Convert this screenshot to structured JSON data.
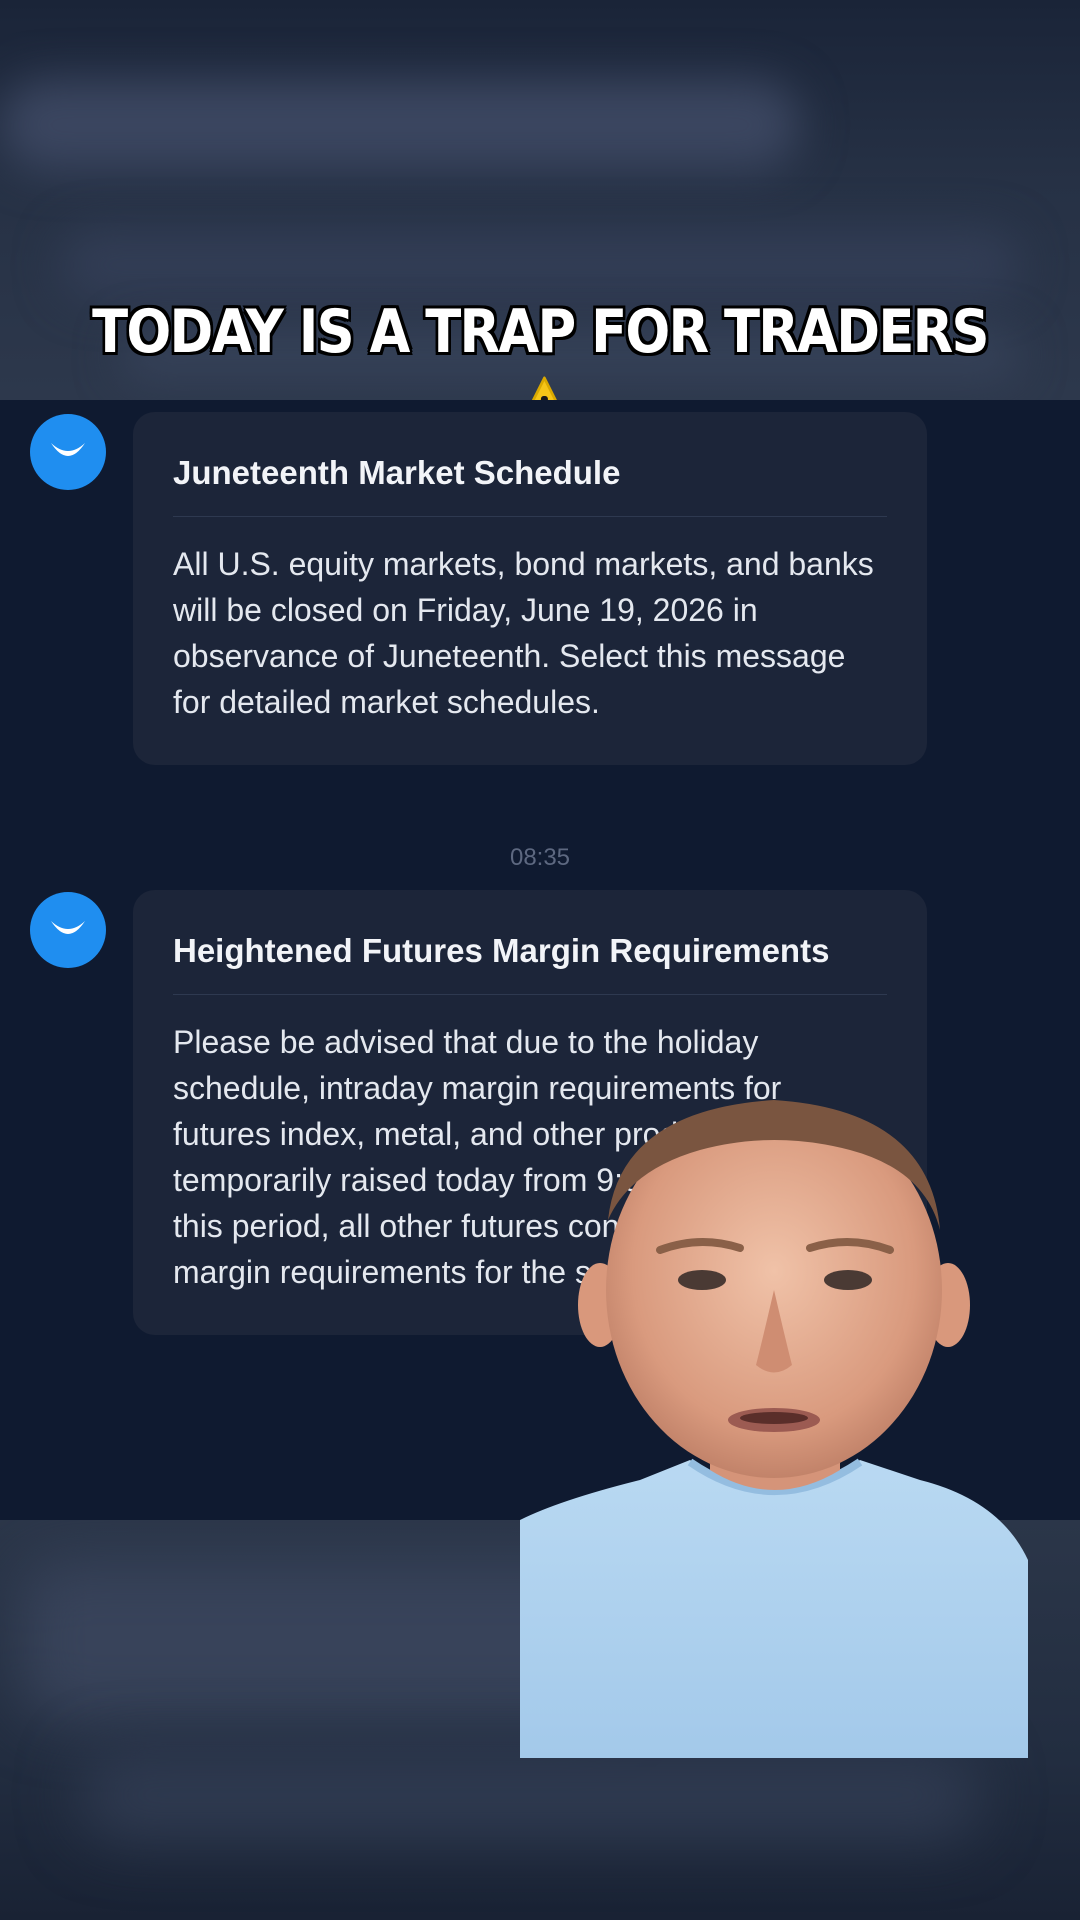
{
  "headline": "TODAY IS A TRAP FOR TRADERS",
  "icons": {
    "headline_icon": "warning-icon",
    "avatar_icon": "smile-logo-icon"
  },
  "colors": {
    "accent": "#1f8ef0",
    "background": "#0f1a30",
    "bubble": "#1c2539",
    "warning": "#f5c518"
  },
  "messages": [
    {
      "title": "Juneteenth Market Schedule",
      "body": "All U.S. equity markets, bond markets, and banks will be closed on Friday, June 19, 2026 in observance of Juneteenth. Select this message for detailed market schedules."
    },
    {
      "title": "Heightened Futures Margin Requirements",
      "body": "Please be advised that due to the holiday schedule, intraday margin requirements for futures index, metal, and other products will be temporarily raised today from 9:00 AM ET– During this period, all other futures contracts will require margin requirements for the session."
    }
  ],
  "timestamp": "08:35"
}
